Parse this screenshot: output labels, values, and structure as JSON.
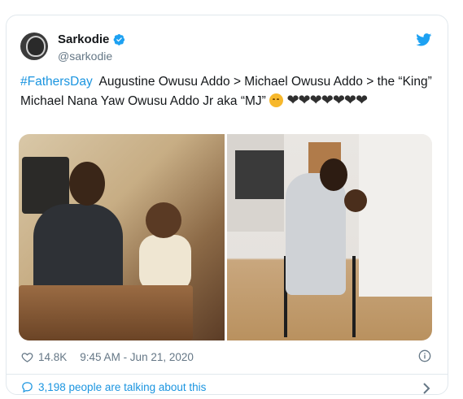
{
  "tweet": {
    "author": {
      "name": "Sarkodie",
      "handle": "@sarkodie"
    },
    "text": {
      "hashtag": "#FathersDay",
      "body": "Augustine Owusu Addo > Michael Owusu Addo > the “King” Michael Nana Yaw Owusu Addo Jr aka “MJ”"
    },
    "likes": "14.8K",
    "timestamp": "9:45 AM - Jun 21, 2020",
    "talking": "3,198 people are talking about this",
    "images": [
      "photo-left",
      "photo-right"
    ]
  },
  "colors": {
    "accent": "#1b95e0",
    "verified": "#1da1f2",
    "text": "#14171a",
    "muted": "#657786"
  }
}
